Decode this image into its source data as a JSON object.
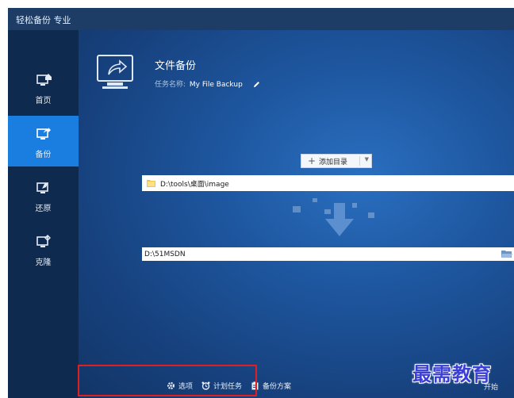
{
  "window": {
    "title": "轻松备份 专业"
  },
  "sidebar": {
    "items": [
      {
        "label": "首页",
        "icon": "home-monitor-icon",
        "active": false
      },
      {
        "label": "备份",
        "icon": "backup-monitor-icon",
        "active": true
      },
      {
        "label": "还原",
        "icon": "restore-monitor-icon",
        "active": false
      },
      {
        "label": "克隆",
        "icon": "clone-monitor-icon",
        "active": false
      }
    ]
  },
  "main": {
    "heading": "文件备份",
    "task_label": "任务名称:",
    "task_name": "My File Backup",
    "add_directory_label": "添加目录",
    "source_path": "D:\\tools\\桌面\\image",
    "destination_path": "D:\\51MSDN"
  },
  "bottom": {
    "options_label": "选项",
    "schedule_label": "计划任务",
    "scheme_label": "备份方案",
    "next_label": "开始"
  },
  "watermark": {
    "text": "最需教育"
  },
  "colors": {
    "sidebar_active": "#1a7de0",
    "highlight_border": "#e02020",
    "watermark": "#3b3fd6"
  }
}
